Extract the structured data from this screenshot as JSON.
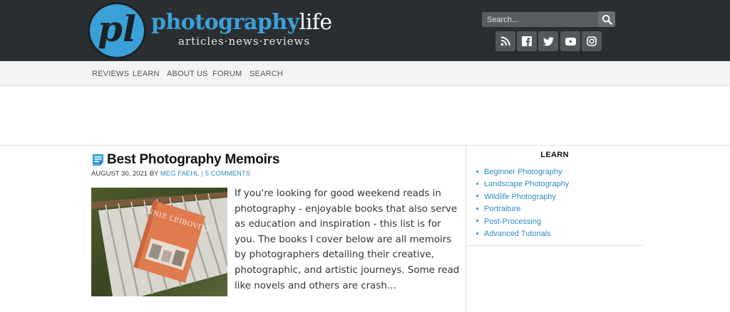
{
  "header": {
    "logo_mark": "pl",
    "logo_word_a": "photography",
    "logo_word_b": "life",
    "logo_tagline": "articles·news·reviews",
    "search_placeholder": "Search...",
    "social": [
      "rss-icon",
      "facebook-icon",
      "twitter-icon",
      "youtube-icon",
      "instagram-icon"
    ]
  },
  "nav": {
    "items": [
      "REVIEWS",
      "LEARN",
      "ABOUT US",
      "FORUM",
      "SEARCH"
    ]
  },
  "article": {
    "title": "Best Photography Memoirs",
    "date": "AUGUST 30, 2021",
    "by": "BY",
    "author": "MEG FAEHL",
    "separator": "|",
    "comments": "5 COMMENTS",
    "image_book_author": "ANNIE LEIBOVITZ",
    "excerpt": "If you're looking for good weekend reads in photography - enjoyable books that also serve as education and inspiration - this list is for you. The books I cover below are all memoirs by photographers detailing their creative, photographic, and artistic journeys. Some read like novels and others are crash..."
  },
  "sidebar": {
    "title": "LEARN",
    "items": [
      "Beginner Photography",
      "Landscape Photography",
      "Wildlife Photography",
      "Portraiture",
      "Post-Processing",
      "Advanced Tutorials"
    ]
  },
  "colors": {
    "header_bg": "#2b2e31",
    "brand_blue": "#3aa1d8",
    "link_blue": "#2f8ac4",
    "nav_bg": "#f3f3f3"
  }
}
